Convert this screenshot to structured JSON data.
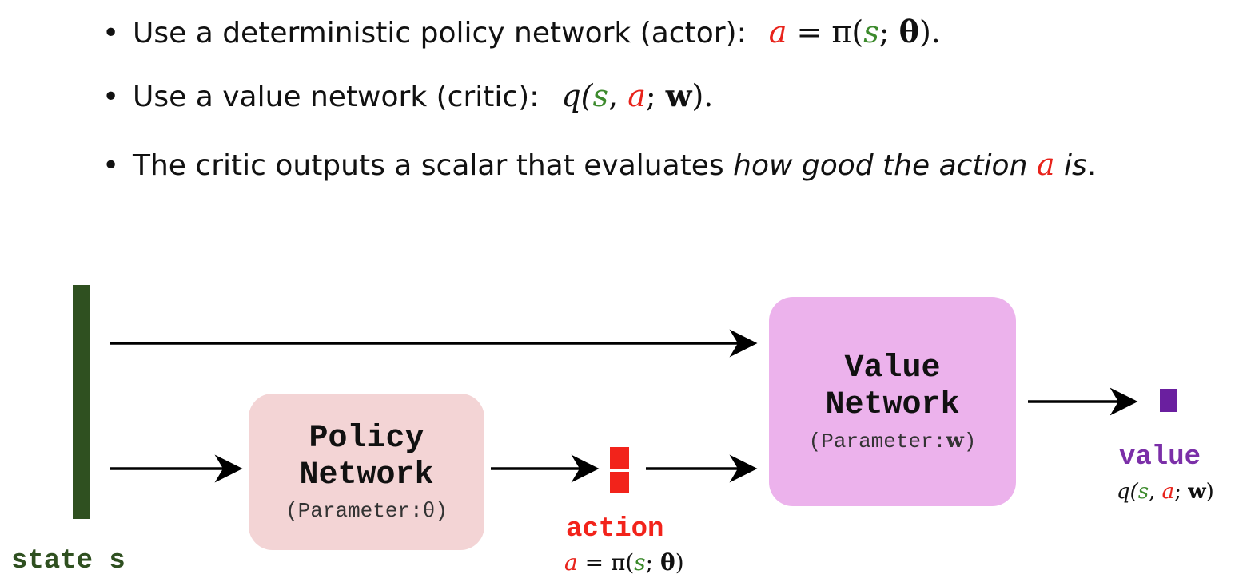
{
  "bullets": [
    {
      "text": "Use a deterministic policy network (actor):",
      "formula": {
        "lhs": "a",
        "eq": " = π(",
        "s": "s",
        "sep": "; ",
        "theta": "θ",
        "close": ")."
      }
    },
    {
      "text": "Use a value network (critic):",
      "formula": {
        "q": "q(",
        "s": "s",
        "comma": ", ",
        "a": "a",
        "sep": "; ",
        "w": "w",
        "close": ")."
      }
    },
    {
      "text_pre": "The critic outputs a scalar that evaluates ",
      "text_italic": "how good the action ",
      "a": "a",
      "text_italic_post": " is",
      "period": "."
    }
  ],
  "state": {
    "label": "state s"
  },
  "policy_network": {
    "title_line1": "Policy",
    "title_line2": "Network",
    "param_prefix": "(Parameter:",
    "param": "θ",
    "param_suffix": ")"
  },
  "value_network": {
    "title_line1": "Value",
    "title_line2": "Network",
    "param_prefix": "(Parameter:",
    "param": "w",
    "param_suffix": ")"
  },
  "action": {
    "label": "action",
    "formula": {
      "a": "a",
      "eq": " = π(",
      "s": "s",
      "sep": "; ",
      "theta": "θ",
      "close": ")"
    }
  },
  "value": {
    "label": "value",
    "formula": {
      "q": "q(",
      "s": "s",
      "comma": ", ",
      "a": "a",
      "sep": "; ",
      "w": "w",
      "close": ")"
    }
  },
  "colors": {
    "state": "#2f5020",
    "action": "#f2231b",
    "value": "#6a1f9f",
    "policy_box": "#f3d4d5",
    "value_box": "#ecb2ec",
    "math_red": "#e8231b",
    "math_green": "#3c8a2c"
  }
}
